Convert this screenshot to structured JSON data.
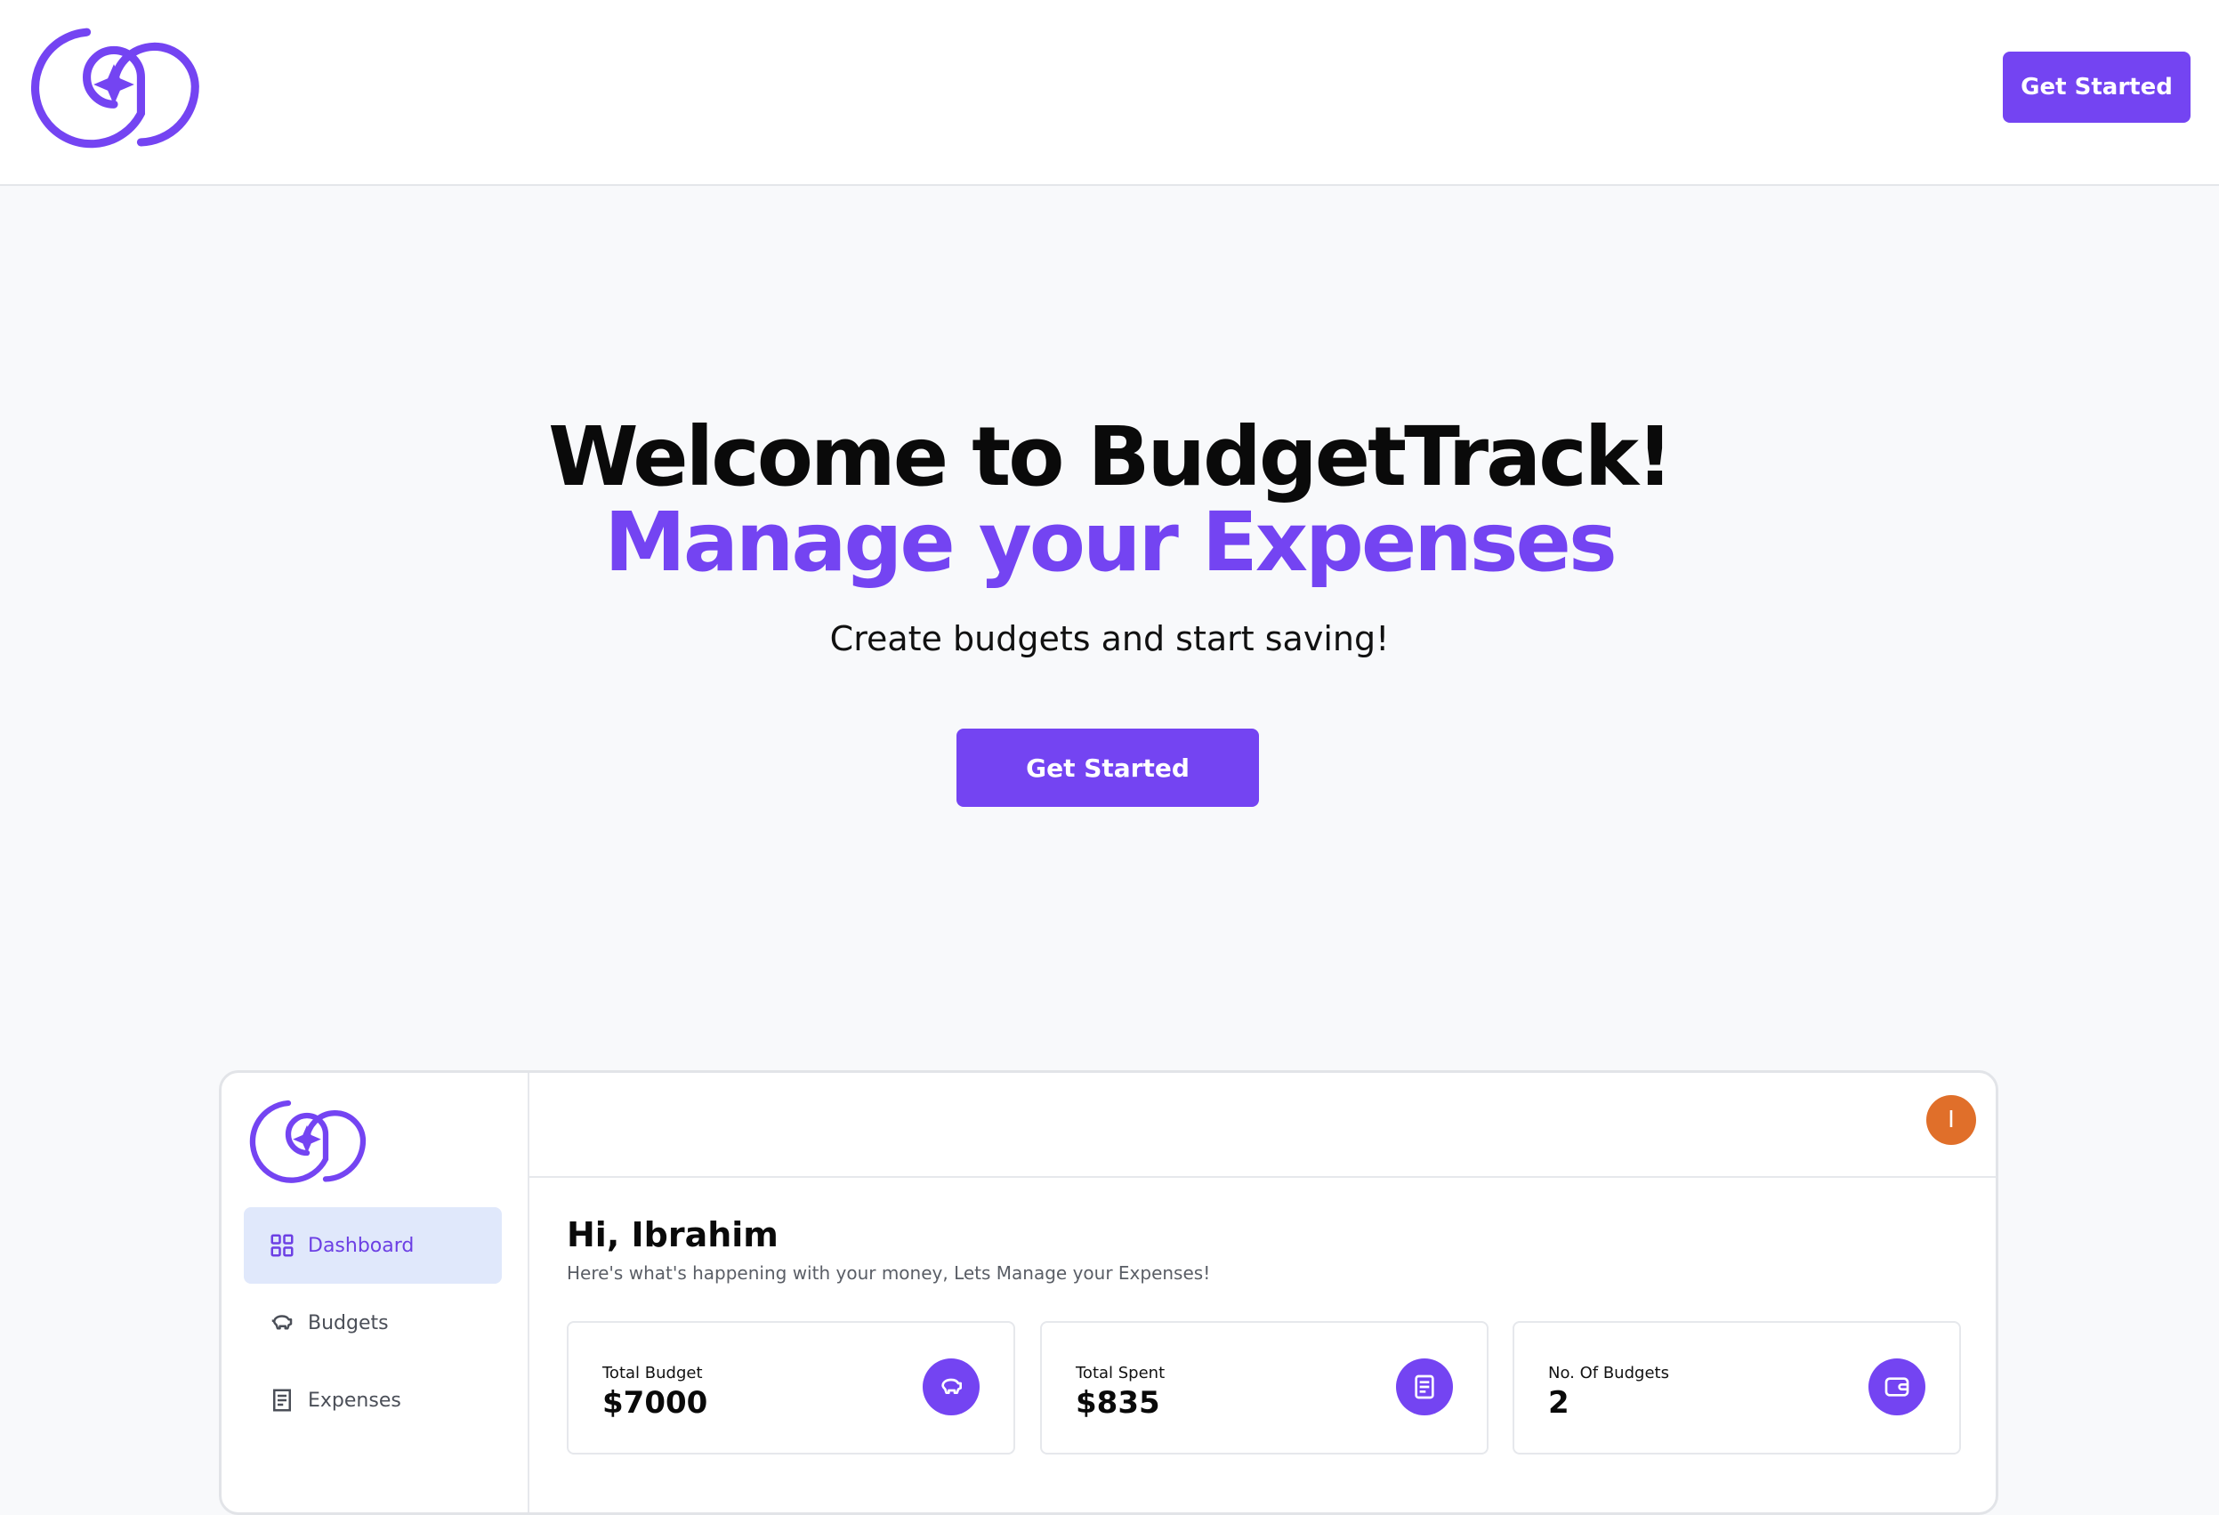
{
  "header": {
    "logo_icon": "budgettrack-logo-icon",
    "cta_label": "Get Started"
  },
  "hero": {
    "title_line1": "Welcome to BudgetTrack!",
    "title_line2": "Manage your Expenses",
    "subtitle": "Create budgets and start saving!",
    "cta_label": "Get Started"
  },
  "colors": {
    "accent": "#7444f2",
    "avatar": "#e06f2a",
    "active_nav_bg": "#e0e8fb"
  },
  "preview": {
    "sidebar": {
      "items": [
        {
          "label": "Dashboard",
          "icon": "grid-icon",
          "active": true
        },
        {
          "label": "Budgets",
          "icon": "piggy-bank-icon",
          "active": false
        },
        {
          "label": "Expenses",
          "icon": "receipt-icon",
          "active": false
        }
      ]
    },
    "avatar_initial": "I",
    "greeting": "Hi, Ibrahim",
    "greeting_sub": "Here's what's happening with your money, Lets Manage your Expenses!",
    "cards": [
      {
        "label": "Total Budget",
        "value": "$7000",
        "icon": "piggy-bank-icon"
      },
      {
        "label": "Total Spent",
        "value": "$835",
        "icon": "receipt-icon"
      },
      {
        "label": "No. Of Budgets",
        "value": "2",
        "icon": "wallet-icon"
      }
    ]
  }
}
